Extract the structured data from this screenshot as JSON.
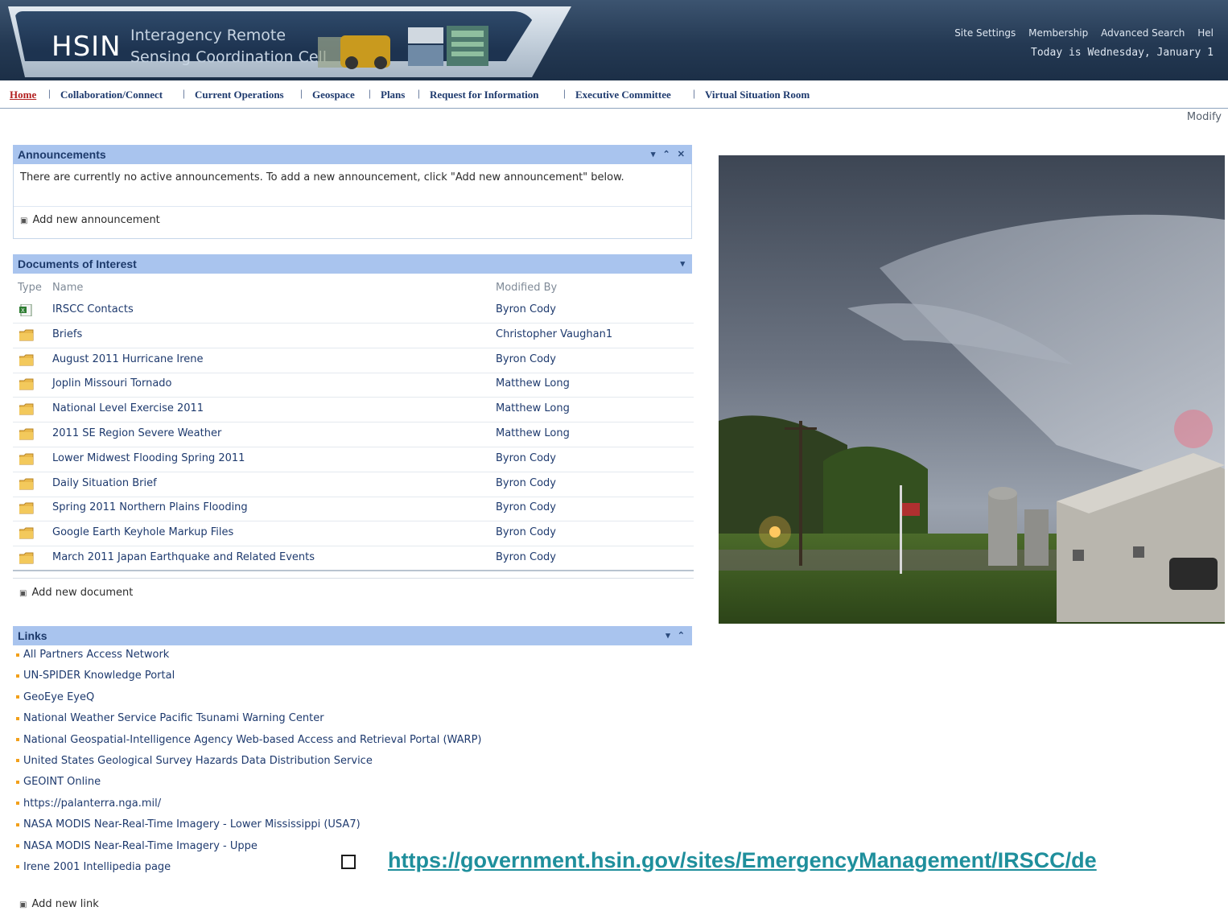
{
  "header": {
    "logo": "HSIN",
    "org_line1": "Interagency Remote",
    "org_line2": "Sensing Coordination Cell",
    "top_links": [
      "Site Settings",
      "Membership",
      "Advanced Search",
      "Hel"
    ],
    "date_text": "Today is Wednesday, January 1"
  },
  "nav": {
    "items": [
      "Home",
      "Collaboration/Connect",
      "Current Operations",
      "Geospace",
      "Plans",
      "Request for Information",
      "Executive Committee",
      "Virtual Situation Room"
    ],
    "active": "Home"
  },
  "modify_link": "Modify",
  "announcements": {
    "title": "Announcements",
    "body": "There are currently no active announcements. To add a new announcement, click \"Add new announcement\" below.",
    "add_label": "Add new announcement"
  },
  "documents": {
    "title": "Documents of Interest",
    "columns": {
      "type": "Type",
      "name": "Name",
      "modified_by": "Modified By"
    },
    "rows": [
      {
        "icon": "excel-file-icon",
        "name": "IRSCC Contacts",
        "modified_by": "Byron Cody"
      },
      {
        "icon": "folder-icon",
        "name": "Briefs",
        "modified_by": "Christopher Vaughan1"
      },
      {
        "icon": "folder-icon",
        "name": "August 2011 Hurricane Irene",
        "modified_by": "Byron Cody"
      },
      {
        "icon": "folder-icon",
        "name": "Joplin Missouri Tornado",
        "modified_by": "Matthew Long"
      },
      {
        "icon": "folder-icon",
        "name": "National Level Exercise 2011",
        "modified_by": "Matthew Long"
      },
      {
        "icon": "folder-icon",
        "name": "2011 SE Region Severe Weather",
        "modified_by": "Matthew Long"
      },
      {
        "icon": "folder-icon",
        "name": "Lower Midwest Flooding Spring 2011",
        "modified_by": "Byron Cody"
      },
      {
        "icon": "folder-icon",
        "name": "Daily Situation Brief",
        "modified_by": "Byron Cody"
      },
      {
        "icon": "folder-icon",
        "name": "Spring 2011 Northern Plains Flooding",
        "modified_by": "Byron Cody"
      },
      {
        "icon": "folder-icon",
        "name": "Google Earth Keyhole Markup Files",
        "modified_by": "Byron Cody"
      },
      {
        "icon": "folder-icon",
        "name": "March 2011 Japan Earthquake and Related Events",
        "modified_by": "Byron Cody"
      }
    ],
    "add_label": "Add new document"
  },
  "links": {
    "title": "Links",
    "items": [
      "All Partners Access Network",
      "UN-SPIDER Knowledge Portal",
      "GeoEye EyeQ",
      "National Weather Service Pacific Tsunami Warning Center",
      "National Geospatial-Intelligence Agency Web-based Access and Retrieval Portal (WARP)",
      "United States Geological Survey Hazards Data Distribution Service",
      "GEOINT Online",
      "https://palanterra.nga.mil/",
      "NASA MODIS Near-Real-Time Imagery - Lower Mississippi (USA7)",
      "NASA MODIS Near-Real-Time Imagery - Uppe",
      "Irene 2001 Intellipedia page"
    ],
    "add_label": "Add new link"
  },
  "callout": {
    "url": "https://government.hsin.gov/sites/EmergencyManagement/IRSCC/de"
  },
  "colors": {
    "webpart_header": "#a9c4ee",
    "link_text": "#1e3a6e",
    "nav_active": "#b32020",
    "callout_url": "#1f8f9c",
    "bullet": "#f2a01b"
  }
}
